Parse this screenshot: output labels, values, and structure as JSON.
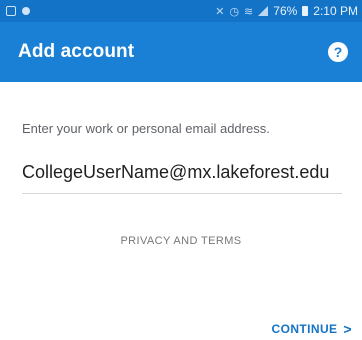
{
  "status_bar": {
    "battery": "76%",
    "time": "2:10 PM",
    "icons": [
      "notification-icon",
      "settings-icon",
      "mute-icon",
      "alarm-icon",
      "wifi-icon",
      "signal-icon",
      "battery-icon"
    ]
  },
  "app_bar": {
    "title": "Add account",
    "help_glyph": "?"
  },
  "form": {
    "prompt": "Enter your work or personal email address.",
    "email_value": "CollegeUserName@mx.lakeforest.edu"
  },
  "links": {
    "privacy": "PRIVACY AND TERMS"
  },
  "actions": {
    "continue_label": "CONTINUE",
    "continue_glyph": ">"
  },
  "colors": {
    "status_bar": "#1373c7",
    "app_bar": "#1a80d5",
    "accent": "#1373c7"
  }
}
